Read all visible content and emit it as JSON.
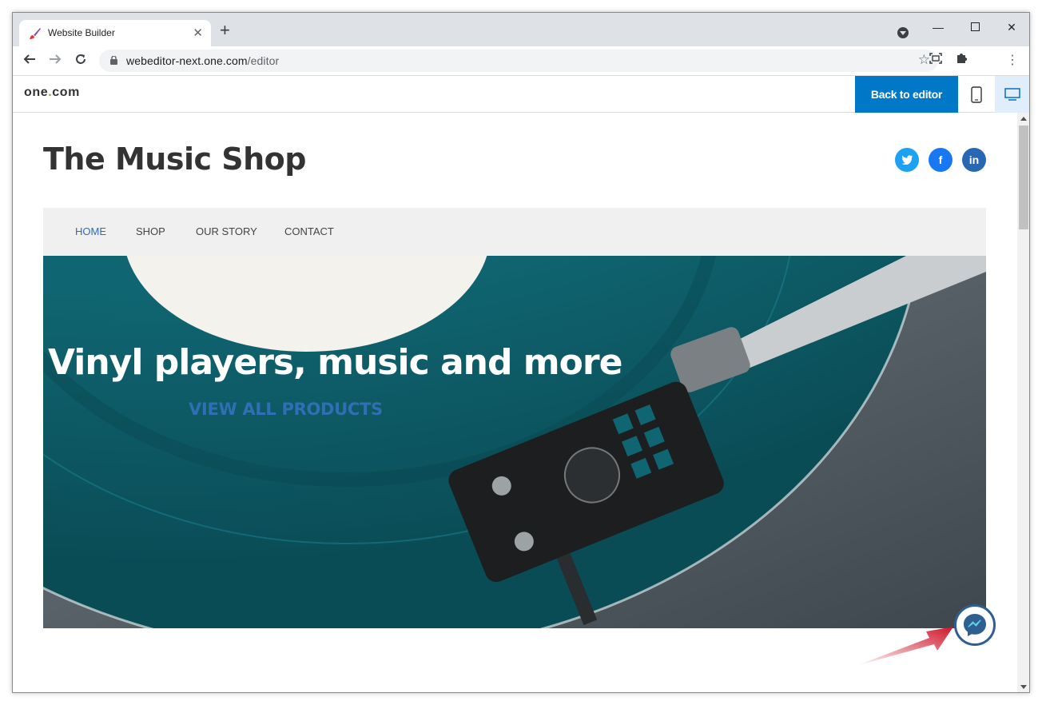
{
  "browser": {
    "tab_title": "Website Builder",
    "url_host": "webeditor-next.one.com",
    "url_path": "/editor"
  },
  "editor": {
    "logo_text_a": "one",
    "logo_dot": ".",
    "logo_text_b": "com",
    "back_button": "Back to editor"
  },
  "site": {
    "title": "The Music Shop",
    "social": [
      "twitter",
      "facebook",
      "linkedin"
    ],
    "nav": [
      "HOME",
      "SHOP",
      "OUR STORY",
      "CONTACT"
    ],
    "hero_headline": "Vinyl players, music and more",
    "hero_link": "VIEW ALL PRODUCTS"
  },
  "colors": {
    "primary_blue": "#0078c8",
    "nav_active": "#2e6db4",
    "hero_link": "#2f6fb3",
    "annotation_red": "#d0162c"
  }
}
